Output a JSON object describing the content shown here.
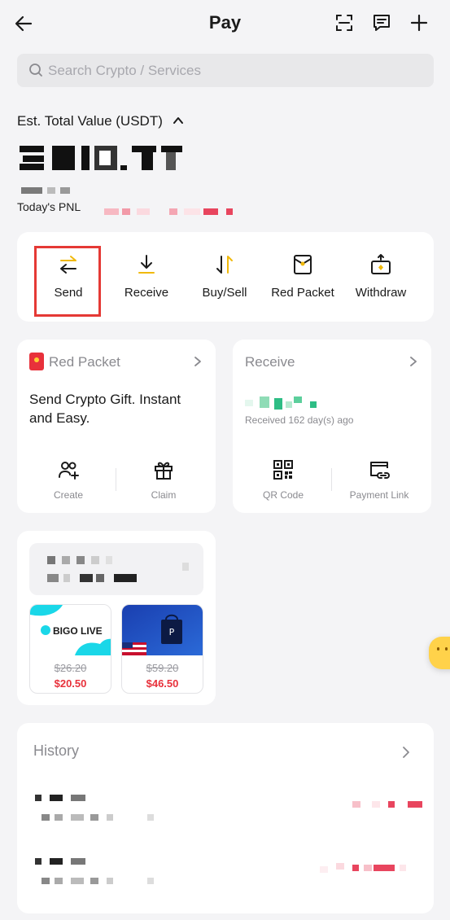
{
  "header": {
    "title": "Pay"
  },
  "search": {
    "placeholder": "Search Crypto / Services"
  },
  "balance": {
    "label": "Est. Total Value (USDT)",
    "pnl_label": "Today's PNL"
  },
  "actions": [
    {
      "label": "Send",
      "icon": "send-arrows-icon",
      "highlighted": true
    },
    {
      "label": "Receive",
      "icon": "download-arrow-icon"
    },
    {
      "label": "Buy/Sell",
      "icon": "buy-sell-arrows-icon"
    },
    {
      "label": "Red Packet",
      "icon": "red-packet-icon"
    },
    {
      "label": "Withdraw",
      "icon": "withdraw-icon"
    }
  ],
  "red_packet": {
    "title": "Red Packet",
    "description": "Send Crypto Gift. Instant and Easy.",
    "create_label": "Create",
    "claim_label": "Claim"
  },
  "receive": {
    "title": "Receive",
    "received_text": "Received 162 day(s) ago",
    "qr_label": "QR Code",
    "payment_link_label": "Payment Link"
  },
  "gift_cards": [
    {
      "brand": "BIGO LIVE",
      "old_price": "$26.20",
      "new_price": "$20.50"
    },
    {
      "brand": "PlayStation",
      "old_price": "$59.20",
      "new_price": "$46.50"
    }
  ],
  "history": {
    "title": "History"
  },
  "colors": {
    "accent": "#e53935",
    "brand_gold": "#f0b90b",
    "price_red": "#e8313b",
    "positive_green": "#2ebd85"
  }
}
